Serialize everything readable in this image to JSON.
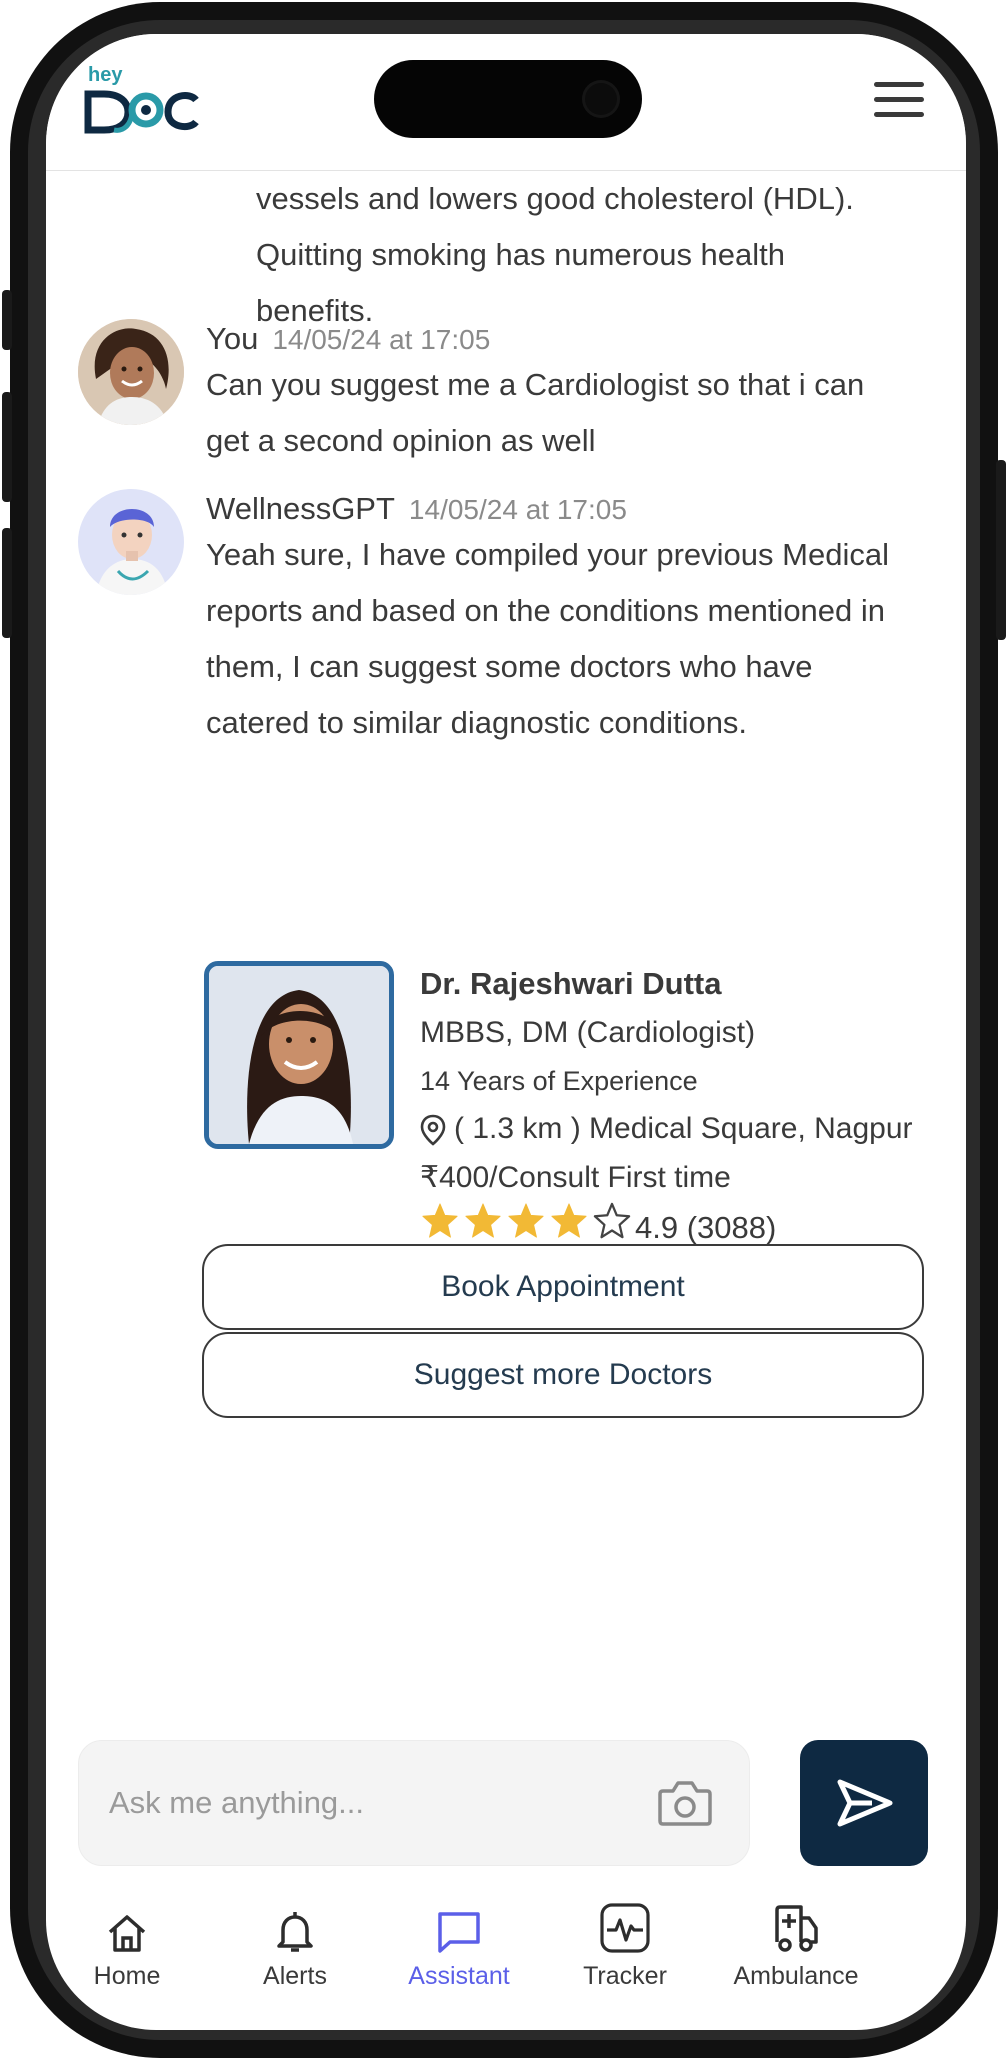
{
  "header": {
    "logo_small": "hey",
    "logo_main": "DOC"
  },
  "chat": {
    "previous_message_lines": [
      "vessels and lowers good cholesterol (HDL).",
      "Quitting smoking has numerous health",
      "benefits."
    ],
    "messages": [
      {
        "sender": "You",
        "timestamp": "14/05/24 at 17:05",
        "lines": [
          "Can you suggest me a Cardiologist so that i can",
          "get a second opinion as well"
        ]
      },
      {
        "sender": "WellnessGPT",
        "timestamp": "14/05/24 at 17:05",
        "lines": [
          "Yeah sure, I have compiled your previous Medical",
          "reports and based on the conditions mentioned in",
          "them, I can suggest some doctors who have",
          "catered to similar diagnostic conditions."
        ]
      }
    ]
  },
  "doctor_card": {
    "name": "Dr. Rajeshwari Dutta",
    "degree": "MBBS, DM (Cardiologist)",
    "experience": "14 Years of Experience",
    "location": "( 1.3 km ) Medical Square, Nagpur",
    "fee": "₹400/Consult First time",
    "rating_value": 4.9,
    "rating_text": "4.9 (3088)",
    "filled_stars": 4,
    "total_stars": 5,
    "star_color": "#f2b935"
  },
  "actions": {
    "book_label": "Book Appointment",
    "suggest_label": "Suggest more Doctors"
  },
  "composer": {
    "placeholder": "Ask me anything...",
    "value": ""
  },
  "bottom_nav": {
    "items": [
      {
        "label": "Home",
        "icon": "home-icon"
      },
      {
        "label": "Alerts",
        "icon": "bell-icon"
      },
      {
        "label": "Assistant",
        "icon": "chat-icon",
        "active": true
      },
      {
        "label": "Tracker",
        "icon": "pulse-icon"
      },
      {
        "label": "Ambulance",
        "icon": "ambulance-icon"
      }
    ],
    "active_color": "#5b5fe8"
  },
  "colors": {
    "brand_dark": "#0e2942",
    "brand_teal": "#2a9aa8",
    "photo_border": "#2e6aa0"
  }
}
